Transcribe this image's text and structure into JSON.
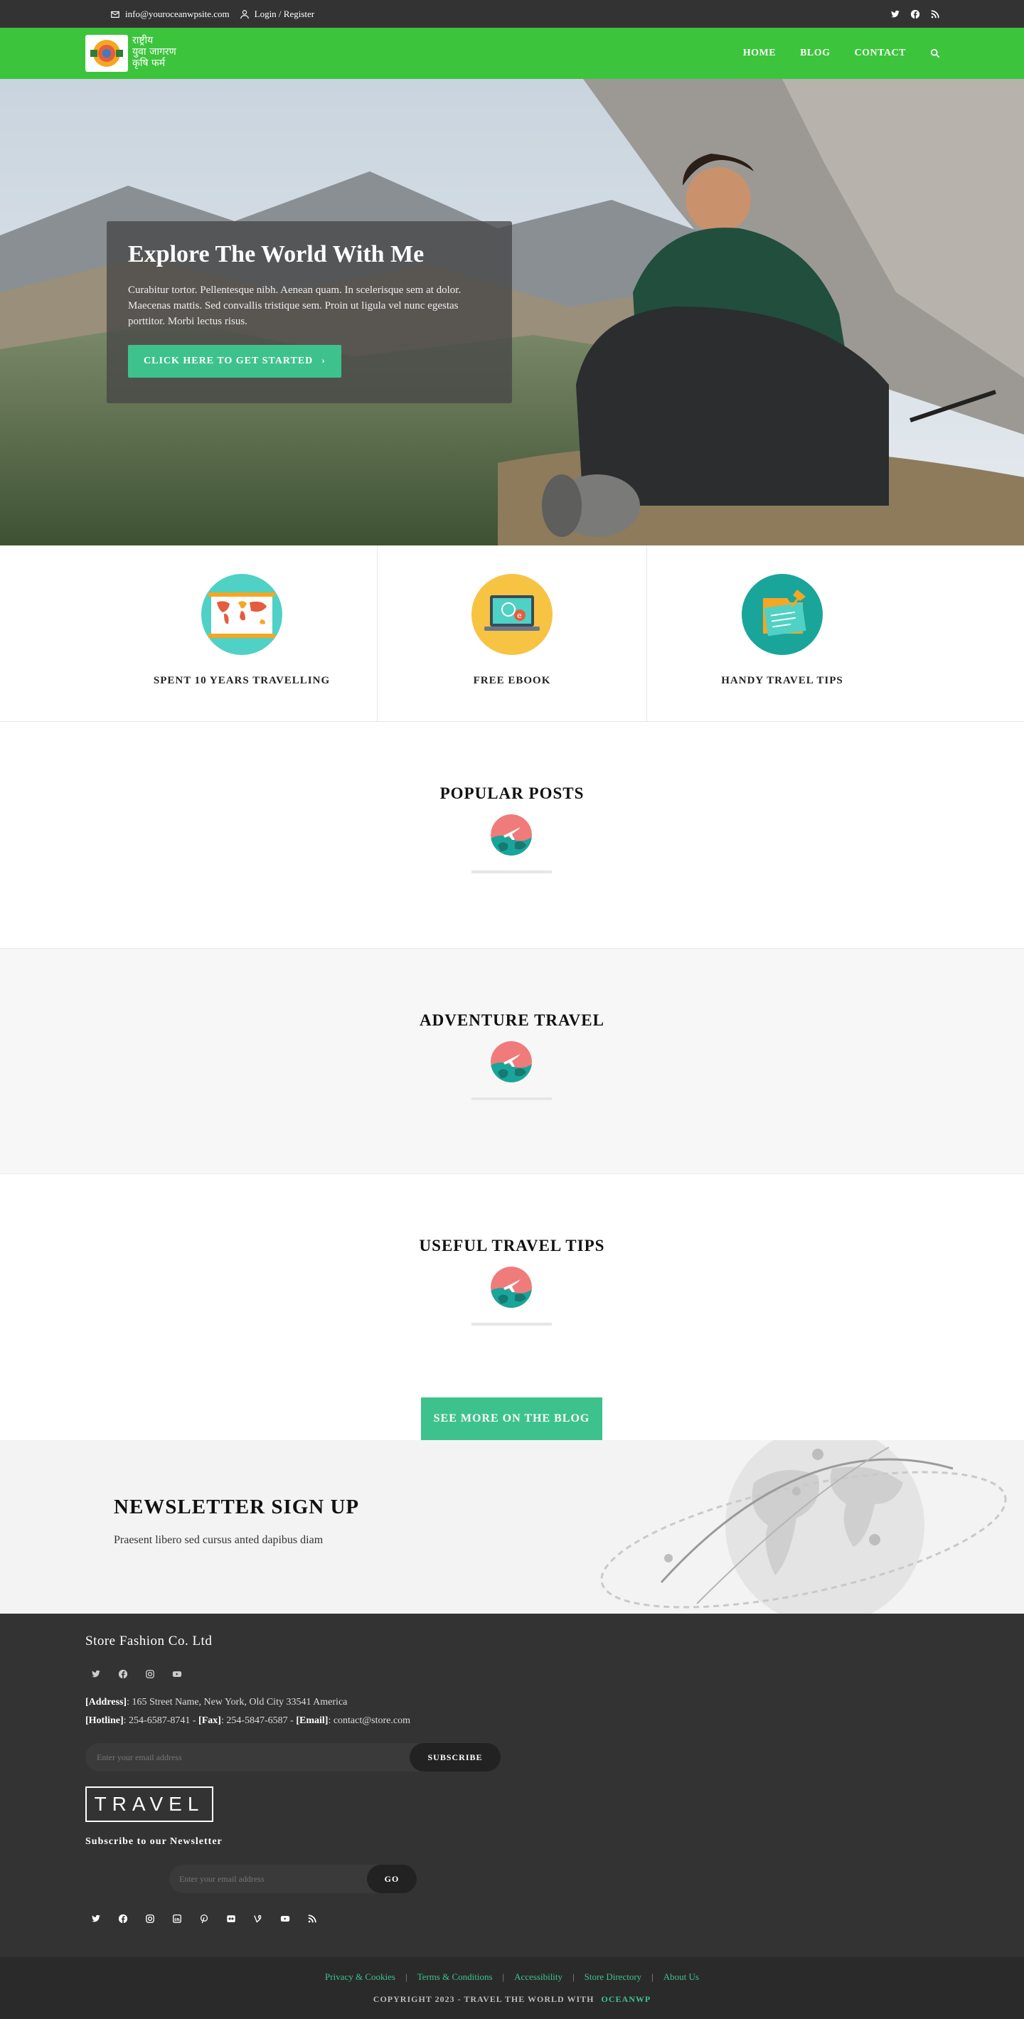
{
  "topbar": {
    "email": "info@youroceanwpsite.com",
    "login": "Login / Register",
    "social_icons": [
      "twitter-icon",
      "facebook-icon",
      "rss-icon"
    ]
  },
  "header": {
    "logo_text": [
      "राष्ट्रीय",
      "युवा जागरण",
      "कृषि फर्म"
    ],
    "nav": [
      "HOME",
      "BLOG",
      "CONTACT"
    ]
  },
  "hero": {
    "title": "Explore The World With Me",
    "text": "Curabitur tortor. Pellentesque nibh. Aenean quam. In scelerisque sem at dolor. Maecenas mattis. Sed convallis tristique sem. Proin ut ligula vel nunc egestas porttitor. Morbi lectus risus.",
    "button": "CLICK HERE TO GET STARTED"
  },
  "features": [
    {
      "label": "SPENT 10 YEARS TRAVELLING",
      "icon": "world-map-icon"
    },
    {
      "label": "FREE EBOOK",
      "icon": "laptop-ebook-icon"
    },
    {
      "label": "HANDY TRAVEL TIPS",
      "icon": "notes-pin-icon"
    }
  ],
  "sections": [
    {
      "title": "POPULAR POSTS"
    },
    {
      "title": "ADVENTURE TRAVEL"
    },
    {
      "title": "USEFUL TRAVEL TIPS"
    }
  ],
  "blog_button": "SEE MORE ON THE BLOG",
  "newsletter": {
    "title": "NEWSLETTER SIGN UP",
    "text": "Praesent libero sed cursus anted dapibus diam"
  },
  "footer": {
    "company": "Store Fashion Co. Ltd",
    "address_label": "[Address]",
    "address": ": 165 Street Name, New York,  Old City 33541 America",
    "hotline_label": "[Hotline]",
    "hotline": ": 254-6587-8741 - ",
    "fax_label": "[Fax]",
    "fax": ": 254-5847-6587 - ",
    "email_label": "[Email]",
    "email": ": contact@store.com",
    "subscribe_placeholder": "Enter your email address",
    "subscribe_button": "SUBSCRIBE",
    "logo": "TRAVEL",
    "newsletter_title": "Subscribe to our Newsletter",
    "newsletter_placeholder": "Enter your email address",
    "newsletter_button": "GO"
  },
  "bottom": {
    "links": [
      "Privacy & Cookies",
      "Terms & Conditions",
      "Accessibility",
      "Store Directory",
      "About Us"
    ],
    "copyright": "COPYRIGHT 2023 - TRAVEL THE WORLD WITH",
    "copyright_accent": "OCEANWP"
  },
  "colors": {
    "header_green": "#3cc43c",
    "accent": "#3ec28d",
    "dark": "#333333"
  }
}
